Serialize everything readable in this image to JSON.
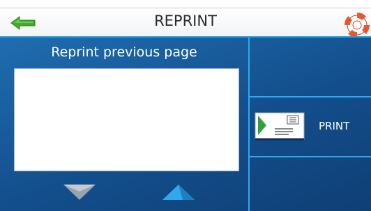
{
  "header": {
    "title": "REPRINT",
    "back_icon": "back-arrow-icon",
    "help_icon": "lifebuoy-help-icon"
  },
  "reprint": {
    "section_title": "Reprint previous page",
    "scroll_down_icon": "triangle-down-icon",
    "scroll_up_icon": "triangle-up-icon"
  },
  "actions": {
    "print_label": "PRINT",
    "print_icon": "print-document-icon"
  },
  "colors": {
    "accent": "#1ea0e0",
    "panel": "#134e8c",
    "back_arrow": "#3fae2a",
    "help_icon": "#e8572c"
  }
}
